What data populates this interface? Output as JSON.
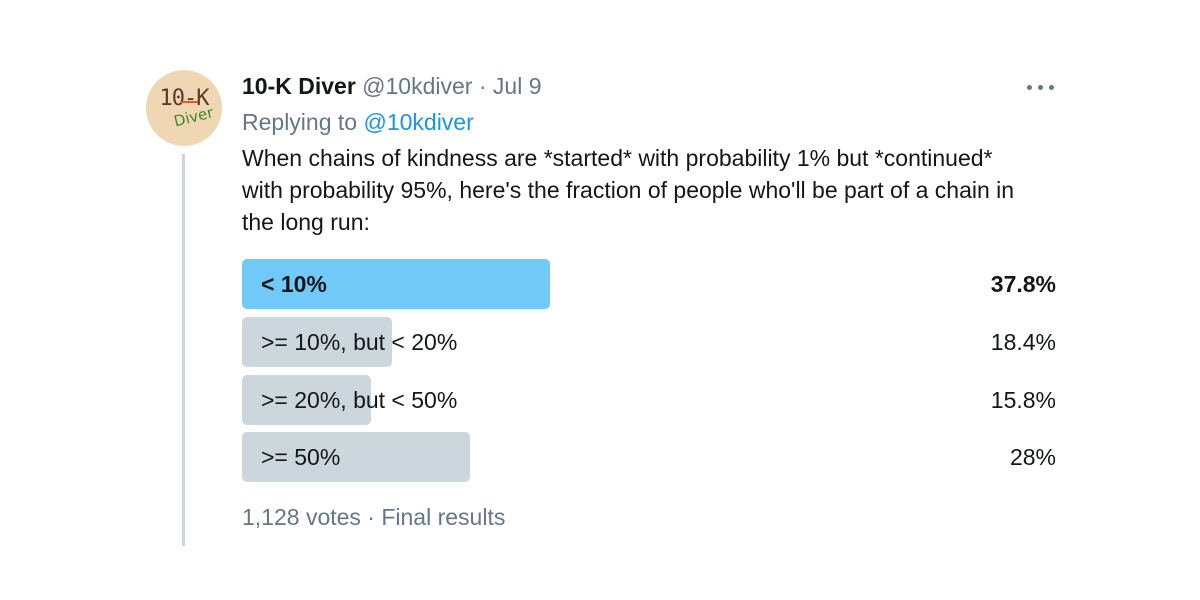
{
  "tweet": {
    "avatar": {
      "line1": "10-K",
      "line2": "Diver",
      "bg_color": "#efd7b4"
    },
    "display_name": "10-K Diver",
    "handle": "@10kdiver",
    "separator": "·",
    "date": "Jul 9",
    "more_icon": "more-horizontal-icon",
    "replying_prefix": "Replying to",
    "replying_handle": "@10kdiver",
    "text_lines": [
      "When chains of kindness are *started* with probability 1% but *continued*",
      "with probability 95%, here's the fraction of people who'll be part of a chain in",
      "the long run:"
    ]
  },
  "poll": {
    "options": [
      {
        "label": "< 10%",
        "percent_text": "37.8%",
        "percent": 37.8,
        "winner": true
      },
      {
        "label": ">= 10%, but < 20%",
        "percent_text": "18.4%",
        "percent": 18.4,
        "winner": false
      },
      {
        "label": ">= 20%, but < 50%",
        "percent_text": "15.8%",
        "percent": 15.8,
        "winner": false
      },
      {
        "label": ">= 50%",
        "percent_text": "28%",
        "percent": 28,
        "winner": false
      }
    ],
    "footer": "1,128 votes · Final results",
    "colors": {
      "winner_bar": "#71c9f8",
      "bar": "#ccd6dd",
      "link": "#1b95e0",
      "muted": "#657786"
    }
  }
}
